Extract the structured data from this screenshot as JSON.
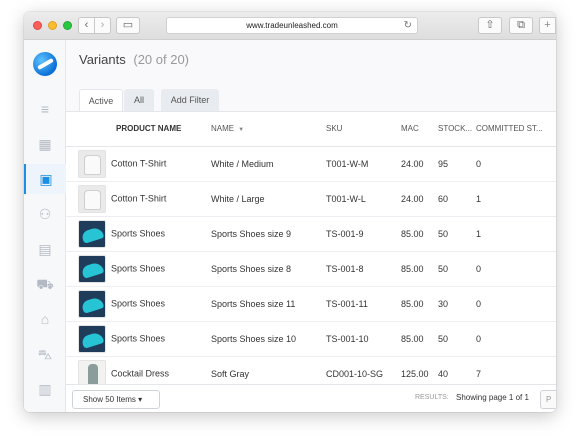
{
  "browser": {
    "url": "www.tradeunleashed.com",
    "icons": {
      "back": "chevron-left-icon",
      "forward": "chevron-right-icon",
      "reload": "reload-icon",
      "share": "share-icon",
      "tabs": "tabs-icon",
      "new_tab": "plus-icon"
    },
    "back_glyph": "‹",
    "forward_glyph": "›",
    "sidebar_glyph": "▭",
    "reload_glyph": "↻",
    "share_glyph": "⇧",
    "tabs_glyph": "⧉",
    "new_tab_glyph": "+"
  },
  "sidebar": {
    "accent": "#1a8fe3",
    "items": [
      {
        "icon": "menu-icon",
        "glyph": "≡"
      },
      {
        "icon": "dashboard-icon",
        "glyph": "▦"
      },
      {
        "icon": "inventory-box-icon",
        "glyph": "▣",
        "active": true
      },
      {
        "icon": "users-icon",
        "glyph": "⚇"
      },
      {
        "icon": "document-icon",
        "glyph": "▤"
      },
      {
        "icon": "cart-add-icon",
        "glyph": "⛟"
      },
      {
        "icon": "factory-icon",
        "glyph": "⌂"
      },
      {
        "icon": "shopping-cart-icon",
        "glyph": "⛍"
      },
      {
        "icon": "reports-chart-icon",
        "glyph": "▥"
      }
    ]
  },
  "header": {
    "title": "Variants",
    "count": "(20 of 20)"
  },
  "tabs": [
    {
      "label": "Active",
      "active": true
    },
    {
      "label": "All"
    },
    {
      "label": "Add Filter"
    }
  ],
  "table": {
    "columns": [
      "PRODUCT NAME",
      "NAME",
      "SKU",
      "MAC",
      "STOCK...",
      "COMMITTED ST..."
    ],
    "sort_glyph": "▼",
    "rows": [
      {
        "thumb": "tshirt",
        "product": "Cotton T-Shirt",
        "name": "White / Medium",
        "sku": "T001-W-M",
        "mac": "24.00",
        "stock": "95",
        "committed": "0"
      },
      {
        "thumb": "tshirt",
        "product": "Cotton T-Shirt",
        "name": "White / Large",
        "sku": "T001-W-L",
        "mac": "24.00",
        "stock": "60",
        "committed": "1"
      },
      {
        "thumb": "shoes",
        "product": "Sports Shoes",
        "name": "Sports Shoes size 9",
        "sku": "TS-001-9",
        "mac": "85.00",
        "stock": "50",
        "committed": "1"
      },
      {
        "thumb": "shoes",
        "product": "Sports Shoes",
        "name": "Sports Shoes size 8",
        "sku": "TS-001-8",
        "mac": "85.00",
        "stock": "50",
        "committed": "0"
      },
      {
        "thumb": "shoes",
        "product": "Sports Shoes",
        "name": "Sports Shoes size 11",
        "sku": "TS-001-11",
        "mac": "85.00",
        "stock": "30",
        "committed": "0"
      },
      {
        "thumb": "shoes",
        "product": "Sports Shoes",
        "name": "Sports Shoes size 10",
        "sku": "TS-001-10",
        "mac": "85.00",
        "stock": "50",
        "committed": "0"
      },
      {
        "thumb": "dress",
        "product": "Cocktail Dress",
        "name": "Soft Gray",
        "sku": "CD001-10-SG",
        "mac": "125.00",
        "stock": "40",
        "committed": "7"
      }
    ]
  },
  "footer": {
    "show_label": "Show 50 Items",
    "show_caret": "▾",
    "results_label": "RESULTS:",
    "page_info": "Showing page 1 of 1",
    "prev_label": "P"
  }
}
